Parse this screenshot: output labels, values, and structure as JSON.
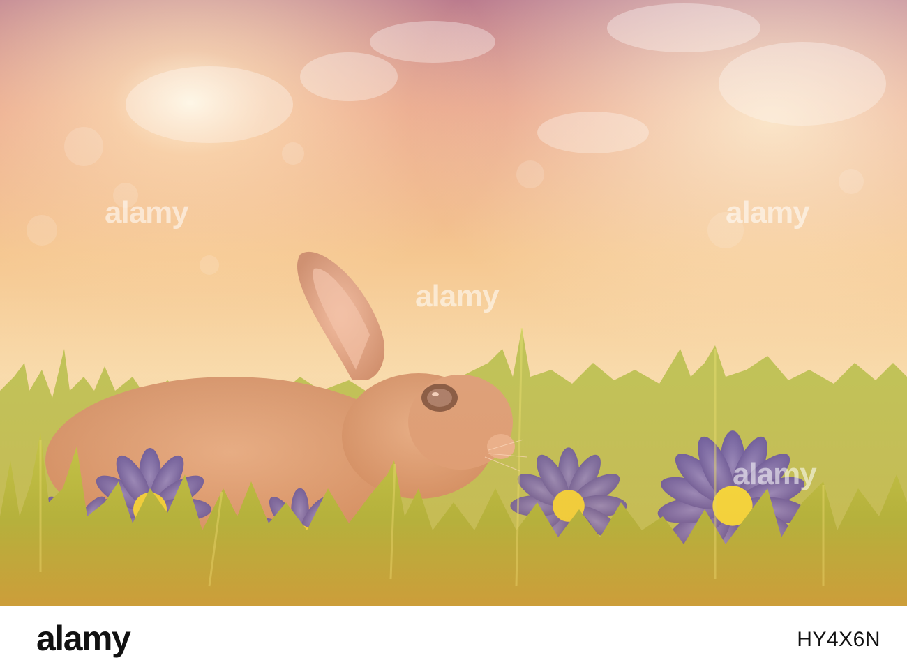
{
  "image": {
    "alt": "",
    "palette": {
      "sky_top": "#c07f8a",
      "sky_mid": "#f2c08e",
      "sky_glow": "#fff3c6",
      "grass_light": "#c7de4a",
      "grass_dark": "#7aa32a",
      "rabbit": "#d8a282",
      "flower_blue": "#5a63c9",
      "flower_center": "#f4ee3a"
    }
  },
  "watermark": {
    "text": "alamy"
  },
  "footer": {
    "logo": "alamy",
    "image_id": "HY4X6N"
  }
}
